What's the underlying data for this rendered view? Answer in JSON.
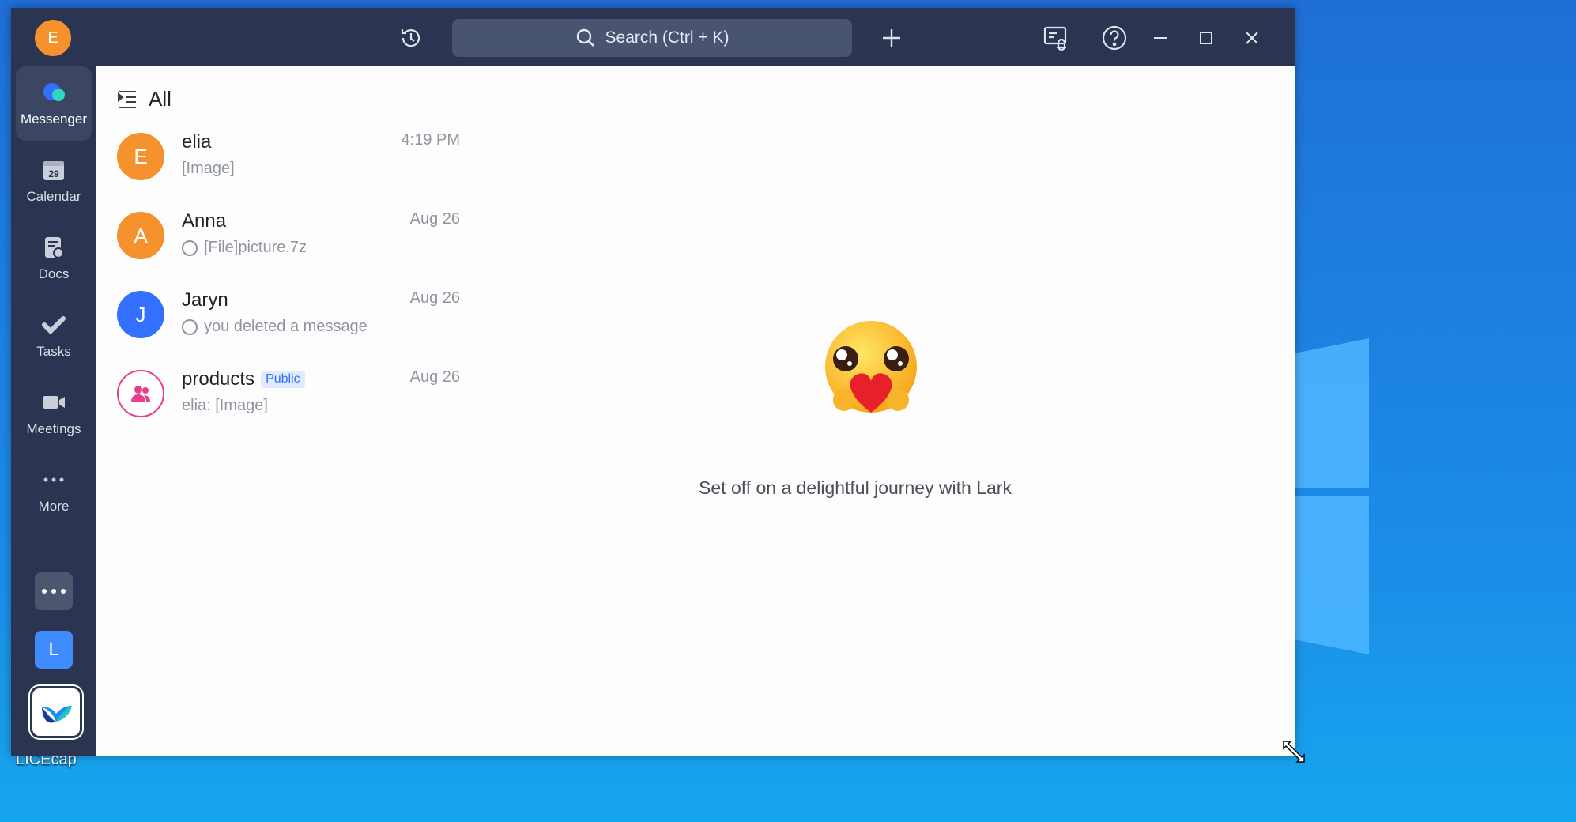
{
  "desktop": {
    "icon_label": "LICEcap"
  },
  "titlebar": {
    "avatar_letter": "E",
    "search_placeholder": "Search (Ctrl + K)"
  },
  "sidebar": {
    "items": [
      {
        "label": "Messenger"
      },
      {
        "label": "Calendar",
        "date": "29"
      },
      {
        "label": "Docs"
      },
      {
        "label": "Tasks"
      },
      {
        "label": "Meetings"
      },
      {
        "label": "More"
      }
    ],
    "bottom_letter": "L"
  },
  "content": {
    "filter_label": "All",
    "chats": [
      {
        "name": "elia",
        "initial": "E",
        "time": "4:19 PM",
        "preview": "[Image]",
        "color": "#f5922d"
      },
      {
        "name": "Anna",
        "initial": "A",
        "time": "Aug 26",
        "preview": "[File]picture.7z",
        "color": "#f5922d"
      },
      {
        "name": "Jaryn",
        "initial": "J",
        "time": "Aug 26",
        "preview": "you deleted a message",
        "color": "#3370ff"
      },
      {
        "name": "products",
        "badge": "Public",
        "time": "Aug 26",
        "preview": "elia: [Image]",
        "color": "#e83e8c"
      }
    ],
    "empty_state_text": "Set off on a delightful journey with Lark"
  }
}
